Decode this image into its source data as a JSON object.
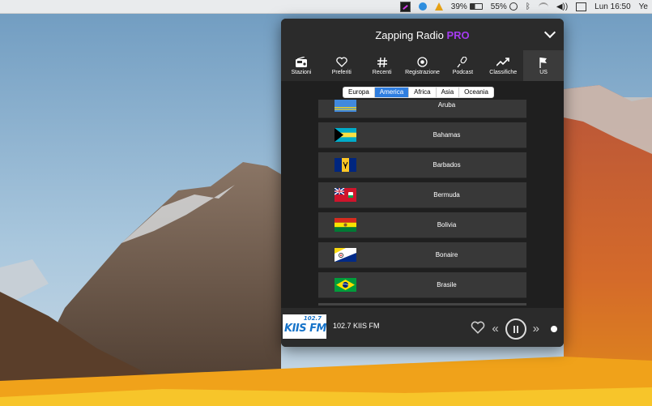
{
  "menubar": {
    "battery_a": "39%",
    "battery_b": "55%",
    "clock": "Lun 16:50",
    "user": "Ye"
  },
  "panel": {
    "title_main": "Zapping Radio",
    "title_pro": "PRO"
  },
  "tabs": [
    {
      "label": "Stazioni",
      "icon": "radio-icon"
    },
    {
      "label": "Preferiti",
      "icon": "heart-icon"
    },
    {
      "label": "Recenti",
      "icon": "hash-icon"
    },
    {
      "label": "Registrazione",
      "icon": "record-icon"
    },
    {
      "label": "Podcast",
      "icon": "microphone-icon"
    },
    {
      "label": "Classifiche",
      "icon": "trend-icon"
    },
    {
      "label": "US",
      "icon": "flag-icon"
    }
  ],
  "active_tab": "US",
  "regions": [
    "Europa",
    "America",
    "Africa",
    "Asia",
    "Oceania"
  ],
  "active_region": "America",
  "countries": [
    "Aruba",
    "Bahamas",
    "Barbados",
    "Bermuda",
    "Bolivia",
    "Bonaire",
    "Brasile"
  ],
  "player": {
    "logo_freq": "102.7",
    "logo_brand": "KIIS FM",
    "station_name": "102.7 KIIS FM"
  },
  "colors": {
    "accent": "#2f7ee0",
    "pro": "#a53bf0",
    "panel_bg": "#1f1f1f"
  }
}
